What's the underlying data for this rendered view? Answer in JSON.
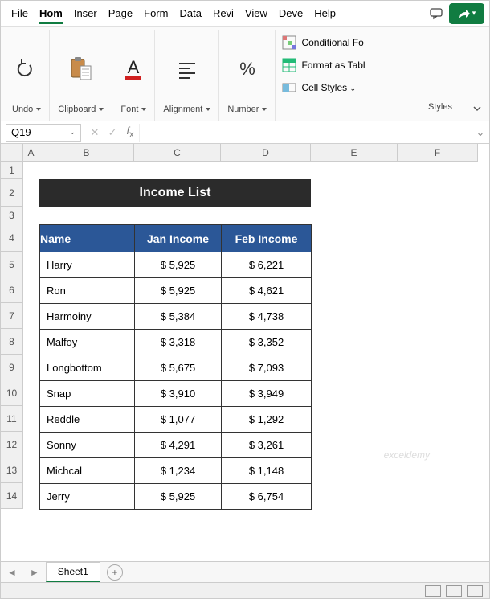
{
  "menu": {
    "tabs": [
      "File",
      "Hom",
      "Inser",
      "Page",
      "Form",
      "Data",
      "Revi",
      "View",
      "Deve",
      "Help"
    ],
    "active_index": 1
  },
  "ribbon": {
    "undo": "Undo",
    "clipboard": "Clipboard",
    "font": "Font",
    "alignment": "Alignment",
    "number": "Number",
    "styles": {
      "conditional": "Conditional Fo",
      "table": "Format as Tabl",
      "cell": "Cell Styles",
      "group": "Styles"
    }
  },
  "formula_bar": {
    "cell_ref": "Q19",
    "formula": ""
  },
  "columns": [
    "A",
    "B",
    "C",
    "D",
    "E",
    "F"
  ],
  "rows": [
    "1",
    "2",
    "3",
    "4",
    "5",
    "6",
    "7",
    "8",
    "9",
    "10",
    "11",
    "12",
    "13",
    "14"
  ],
  "sheet": {
    "title": "Income List",
    "headers": [
      "Name",
      "Jan Income",
      "Feb Income"
    ],
    "data": [
      {
        "name": "Harry",
        "jan": "$ 5,925",
        "feb": "$ 6,221"
      },
      {
        "name": "Ron",
        "jan": "$ 5,925",
        "feb": "$ 4,621"
      },
      {
        "name": "Harmoiny",
        "jan": "$ 5,384",
        "feb": "$ 4,738"
      },
      {
        "name": "Malfoy",
        "jan": "$ 3,318",
        "feb": "$ 3,352"
      },
      {
        "name": "Longbottom",
        "jan": "$ 5,675",
        "feb": "$ 7,093"
      },
      {
        "name": "Snap",
        "jan": "$ 3,910",
        "feb": "$ 3,949"
      },
      {
        "name": "Reddle",
        "jan": "$ 1,077",
        "feb": "$ 1,292"
      },
      {
        "name": "Sonny",
        "jan": "$ 4,291",
        "feb": "$ 3,261"
      },
      {
        "name": "Michcal",
        "jan": "$ 1,234",
        "feb": "$ 1,148"
      },
      {
        "name": "Jerry",
        "jan": "$ 5,925",
        "feb": "$ 6,754"
      }
    ]
  },
  "sheet_tab": "Sheet1",
  "watermark": "exceldemy"
}
